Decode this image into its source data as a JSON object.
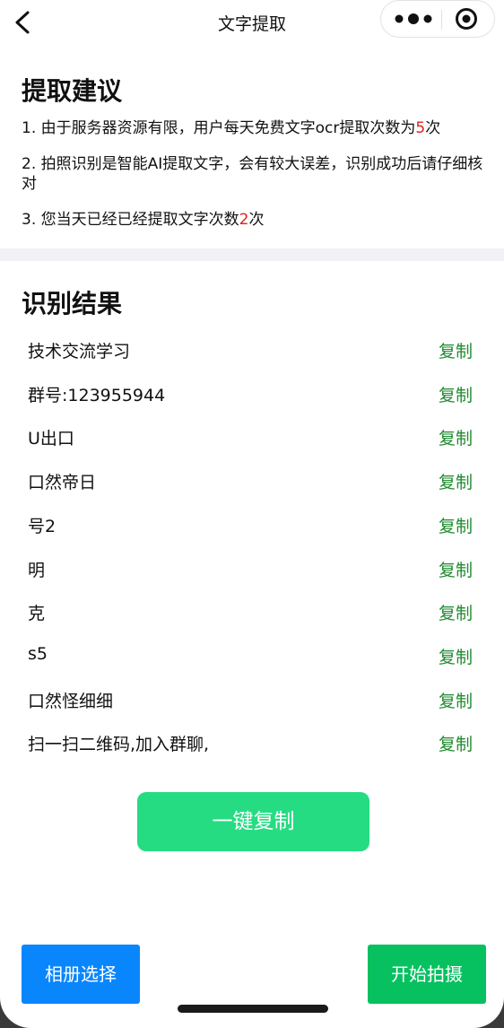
{
  "header": {
    "title": "文字提取"
  },
  "suggest": {
    "heading": "提取建议",
    "tip1_prefix": "1. 由于服务器资源有限，用户每天免费文字ocr提取次数为",
    "tip1_count": "5",
    "tip1_suffix": "次",
    "tip2": "2. 拍照识别是智能AI提取文字，会有较大误差，识别成功后请仔细核对",
    "tip3_prefix": "3. 您当天已经已经提取文字次数",
    "tip3_count": "2",
    "tip3_suffix": "次"
  },
  "result": {
    "heading": "识别结果",
    "copy_label": "复制",
    "items": [
      "技术交流学习",
      "群号:123955944",
      "U出口",
      "口然帝日",
      "号2",
      "明",
      "克",
      "s5",
      "口然怪细细",
      "扫一扫二维码,加入群聊,"
    ]
  },
  "actions": {
    "copy_all": "一键复制",
    "album": "相册选择",
    "shoot": "开始拍摄"
  },
  "colors": {
    "accent_red": "#e02020",
    "copy_green": "#1f8a2f",
    "copy_all_bg": "#26dc82",
    "album_bg": "#0a86fc",
    "shoot_bg": "#07c160"
  },
  "icons": [
    "back-arrow-icon",
    "more-dots-icon",
    "target-icon"
  ]
}
